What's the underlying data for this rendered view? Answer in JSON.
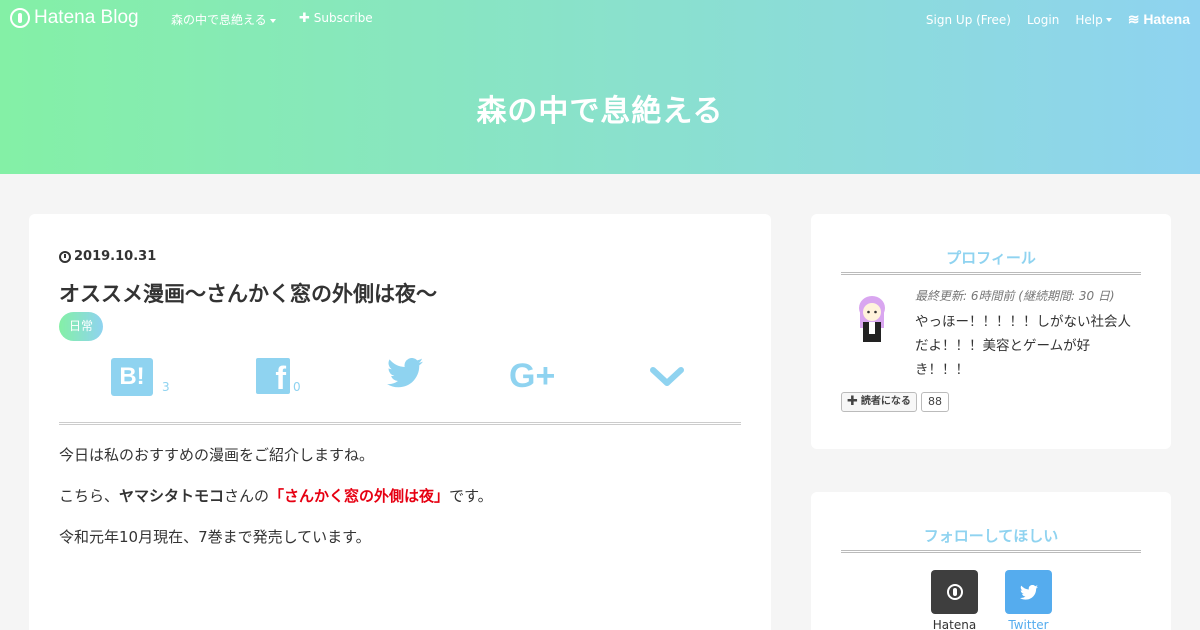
{
  "topbar": {
    "brand": "Hatena Blog",
    "blog_name": "森の中で息絶える",
    "subscribe": "Subscribe",
    "signup": "Sign Up (Free)",
    "login": "Login",
    "help": "Help",
    "hatena": "Hatena"
  },
  "site_title": "森の中で息絶える",
  "entry": {
    "date": "2019.10.31",
    "title": "オススメ漫画～さんかく窓の外側は夜～",
    "category": "日常",
    "share": {
      "hatebu_label": "B!",
      "hatebu_count": "3",
      "facebook_label": "f",
      "facebook_count": "0",
      "gplus_label": "G+"
    },
    "paragraphs": {
      "p1": "今日は私のおすすめの漫画をご紹介しますね。",
      "p2_prefix": "こちら、",
      "p2_author": "ヤマシタトモコ",
      "p2_mid": "さんの",
      "p2_title": "「さんかく窓の外側は夜」",
      "p2_suffix": "です。",
      "p3": "令和元年10月現在、7巻まで発売しています。"
    }
  },
  "profile": {
    "heading": "プロフィール",
    "last_update": "最終更新: 6時間前 (継続期間: 30 日)",
    "bio": "やっほー！！！！！しがない社会人だよ！！！美容とゲームが好き！！！",
    "reader_button": "読者になる",
    "reader_count": "88"
  },
  "follow": {
    "heading": "フォローしてほしい",
    "hatena_label": "Hatena",
    "twitter_label": "Twitter"
  },
  "colors": {
    "gradient_start": "#84f0a6",
    "gradient_end": "#8fd3f0",
    "accent": "#8fd3f0",
    "highlight_red": "#e60012",
    "twitter_blue": "#55acee"
  }
}
